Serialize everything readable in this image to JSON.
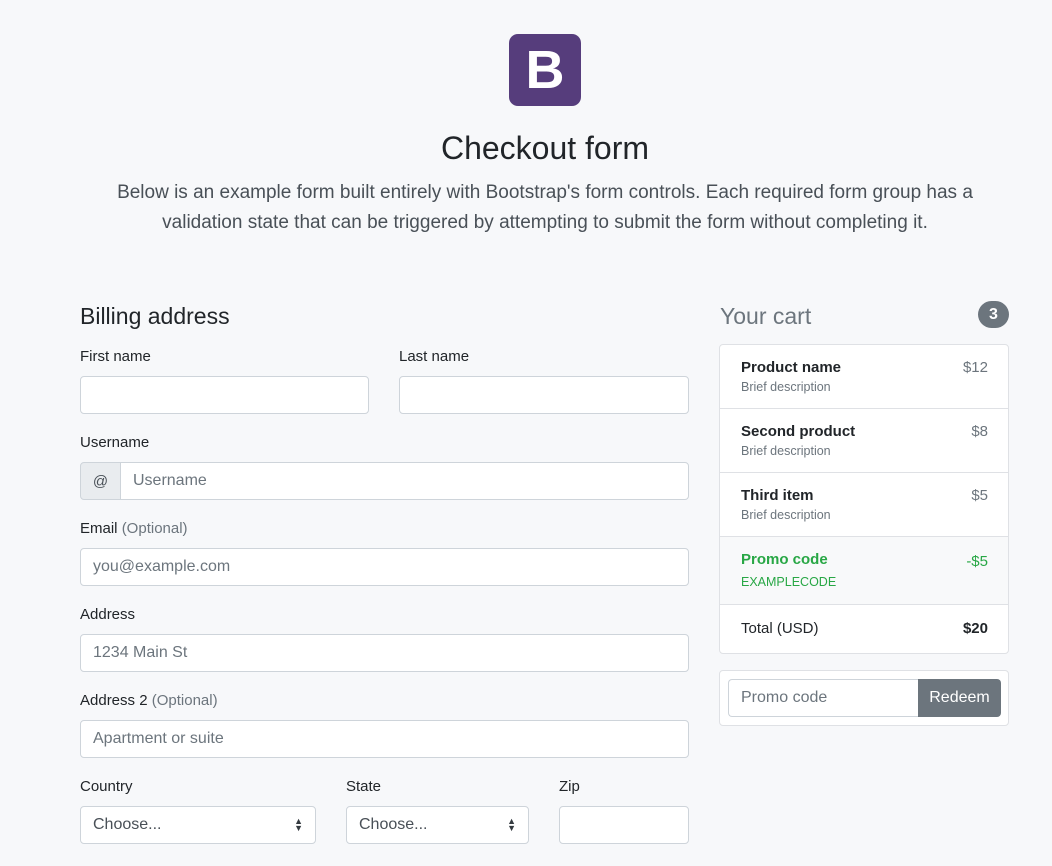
{
  "header": {
    "logo_letter": "B",
    "title": "Checkout form",
    "lead": "Below is an example form built entirely with Bootstrap's form controls. Each required form group has a validation state that can be triggered by attempting to submit the form without completing it."
  },
  "billing": {
    "title": "Billing address",
    "first_name_label": "First name",
    "last_name_label": "Last name",
    "username_label": "Username",
    "username_prefix": "@",
    "username_placeholder": "Username",
    "email_label": "Email",
    "email_optional": "(Optional)",
    "email_placeholder": "you@example.com",
    "address_label": "Address",
    "address_placeholder": "1234 Main St",
    "address2_label": "Address 2",
    "address2_optional": "(Optional)",
    "address2_placeholder": "Apartment or suite",
    "country_label": "Country",
    "country_value": "Choose...",
    "state_label": "State",
    "state_value": "Choose...",
    "zip_label": "Zip"
  },
  "cart": {
    "title": "Your cart",
    "count": "3",
    "items": [
      {
        "name": "Product name",
        "desc": "Brief description",
        "price": "$12"
      },
      {
        "name": "Second product",
        "desc": "Brief description",
        "price": "$8"
      },
      {
        "name": "Third item",
        "desc": "Brief description",
        "price": "$5"
      }
    ],
    "promo": {
      "name": "Promo code",
      "code": "EXAMPLECODE",
      "amount": "-$5"
    },
    "total_label": "Total (USD)",
    "total_value": "$20",
    "promo_placeholder": "Promo code",
    "redeem_label": "Redeem"
  },
  "colors": {
    "brand": "#563d7c",
    "success": "#28a745",
    "secondary": "#6c757d"
  }
}
